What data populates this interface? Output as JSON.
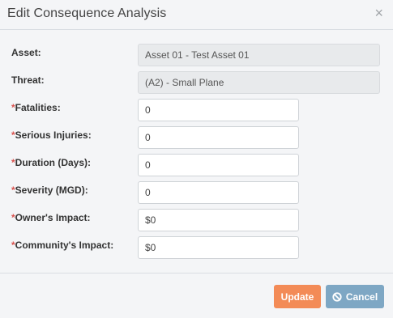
{
  "dialog": {
    "title": "Edit Consequence Analysis",
    "close_glyph": "×"
  },
  "fields": {
    "asset": {
      "label": "Asset:",
      "value": "Asset 01 - Test Asset 01"
    },
    "threat": {
      "label": "Threat:",
      "value": "(A2) - Small Plane"
    },
    "fatalities": {
      "required_mark": "*",
      "label": "Fatalities:",
      "value": "0"
    },
    "serious_injuries": {
      "required_mark": "*",
      "label": "Serious Injuries:",
      "value": "0"
    },
    "duration": {
      "required_mark": "*",
      "label": "Duration (Days):",
      "value": "0"
    },
    "severity": {
      "required_mark": "*",
      "label": "Severity (MGD):",
      "value": "0"
    },
    "owners_impact": {
      "required_mark": "*",
      "label": "Owner's Impact:",
      "value": "$0"
    },
    "community_impact": {
      "required_mark": "*",
      "label": "Community's Impact:",
      "value": "$0"
    }
  },
  "buttons": {
    "update_label": "Update",
    "cancel_label": "Cancel",
    "cancel_icon": "ban-icon"
  },
  "colors": {
    "required": "#d9534f",
    "update_button": "#f38b57",
    "cancel_button": "#7ea7c4"
  }
}
